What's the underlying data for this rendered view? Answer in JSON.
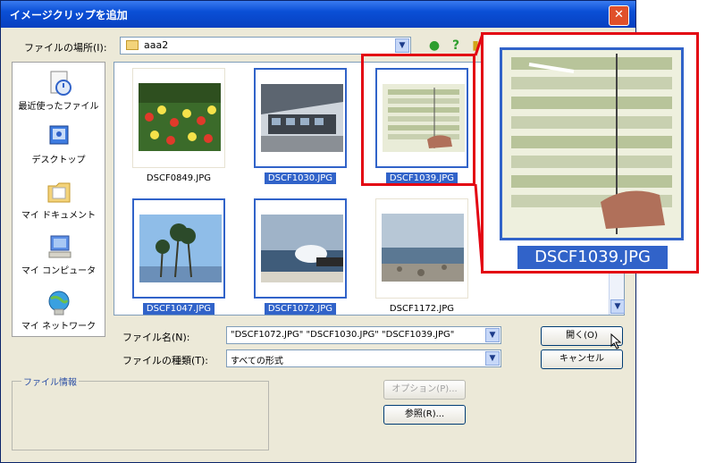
{
  "window": {
    "title": "イメージクリップを追加"
  },
  "location": {
    "label": "ファイルの場所(I):",
    "value": "aaa2"
  },
  "places": [
    {
      "label": "最近使ったファイル"
    },
    {
      "label": "デスクトップ"
    },
    {
      "label": "マイ ドキュメント"
    },
    {
      "label": "マイ コンピュータ"
    },
    {
      "label": "マイ ネットワーク"
    }
  ],
  "files": [
    {
      "name": "DSCF0849.JPG",
      "selected": false
    },
    {
      "name": "DSCF1030.JPG",
      "selected": true
    },
    {
      "name": "DSCF1039.JPG",
      "selected": true
    },
    {
      "name": "DSCF1047.JPG",
      "selected": true
    },
    {
      "name": "DSCF1072.JPG",
      "selected": true
    },
    {
      "name": "DSCF1172.JPG",
      "selected": false
    }
  ],
  "filename": {
    "label": "ファイル名(N):",
    "value": "\"DSCF1072.JPG\" \"DSCF1030.JPG\" \"DSCF1039.JPG\""
  },
  "filetype": {
    "label": "ファイルの種類(T):",
    "value": "すべての形式"
  },
  "buttons": {
    "open": "開く(O)",
    "cancel": "キャンセル",
    "options": "オプション(P)...",
    "import": "参照(R)..."
  },
  "fileinfo": {
    "label": "ファイル情報"
  },
  "zoom": {
    "name": "DSCF1039.JPG"
  },
  "colors": {
    "selection": "#3163c9",
    "callout": "#e30613",
    "titlebar": "#0a4fd6"
  }
}
